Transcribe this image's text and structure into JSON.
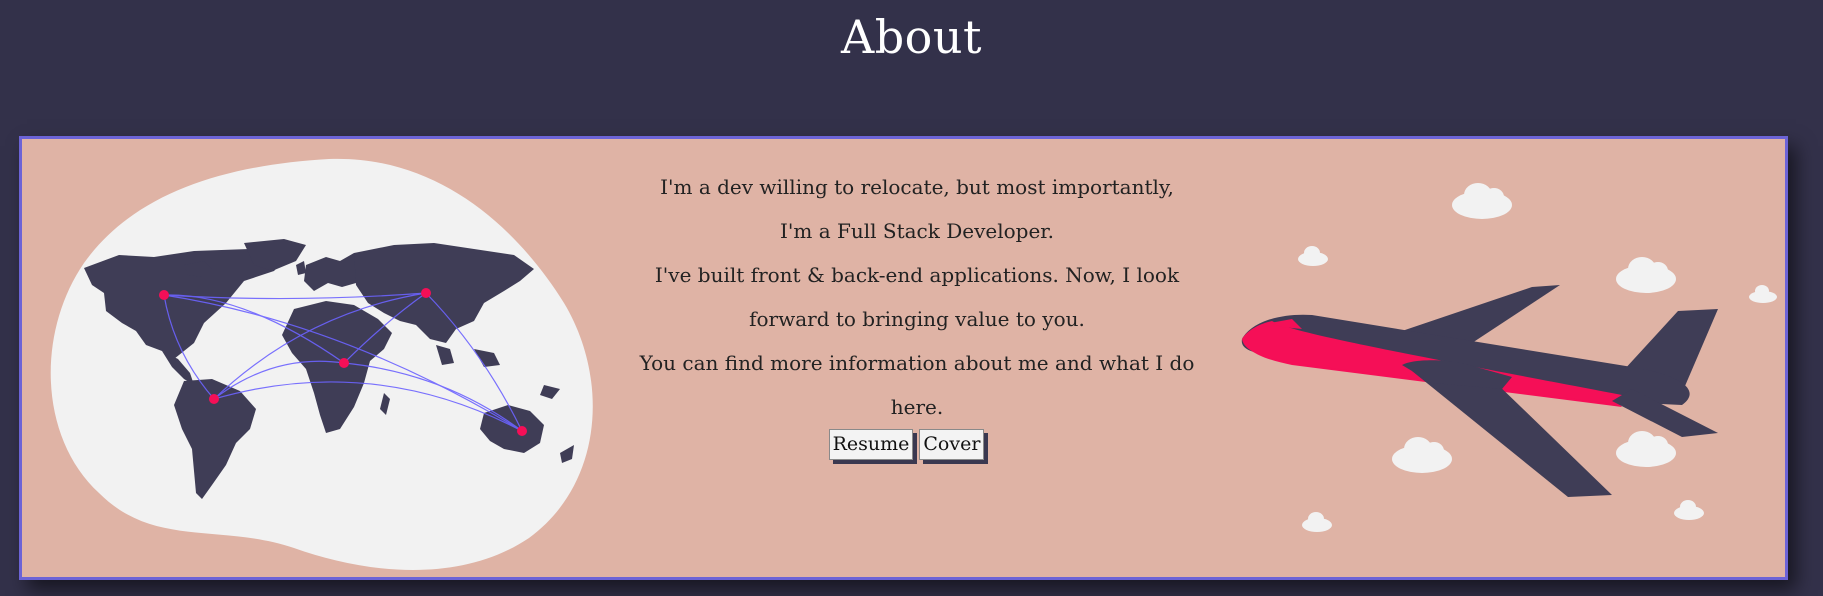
{
  "page": {
    "title": "About"
  },
  "about": {
    "paragraphs": [
      "I'm a dev willing to relocate, but most importantly,",
      "I'm a Full Stack Developer.",
      "I've built front & back-end applications. Now, I look forward to bringing value to you.",
      "You can find more information about me and what I do here."
    ]
  },
  "buttons": {
    "resume_label": "Resume",
    "cover_label": "Cover"
  },
  "illustrations": {
    "left": "world-map-icon",
    "right": "airplane-icon"
  },
  "colors": {
    "background": "#33314a",
    "card": "#dfb3a5",
    "card_border": "#6c63d6",
    "accent": "#f50f57",
    "dark": "#3f3d56"
  }
}
